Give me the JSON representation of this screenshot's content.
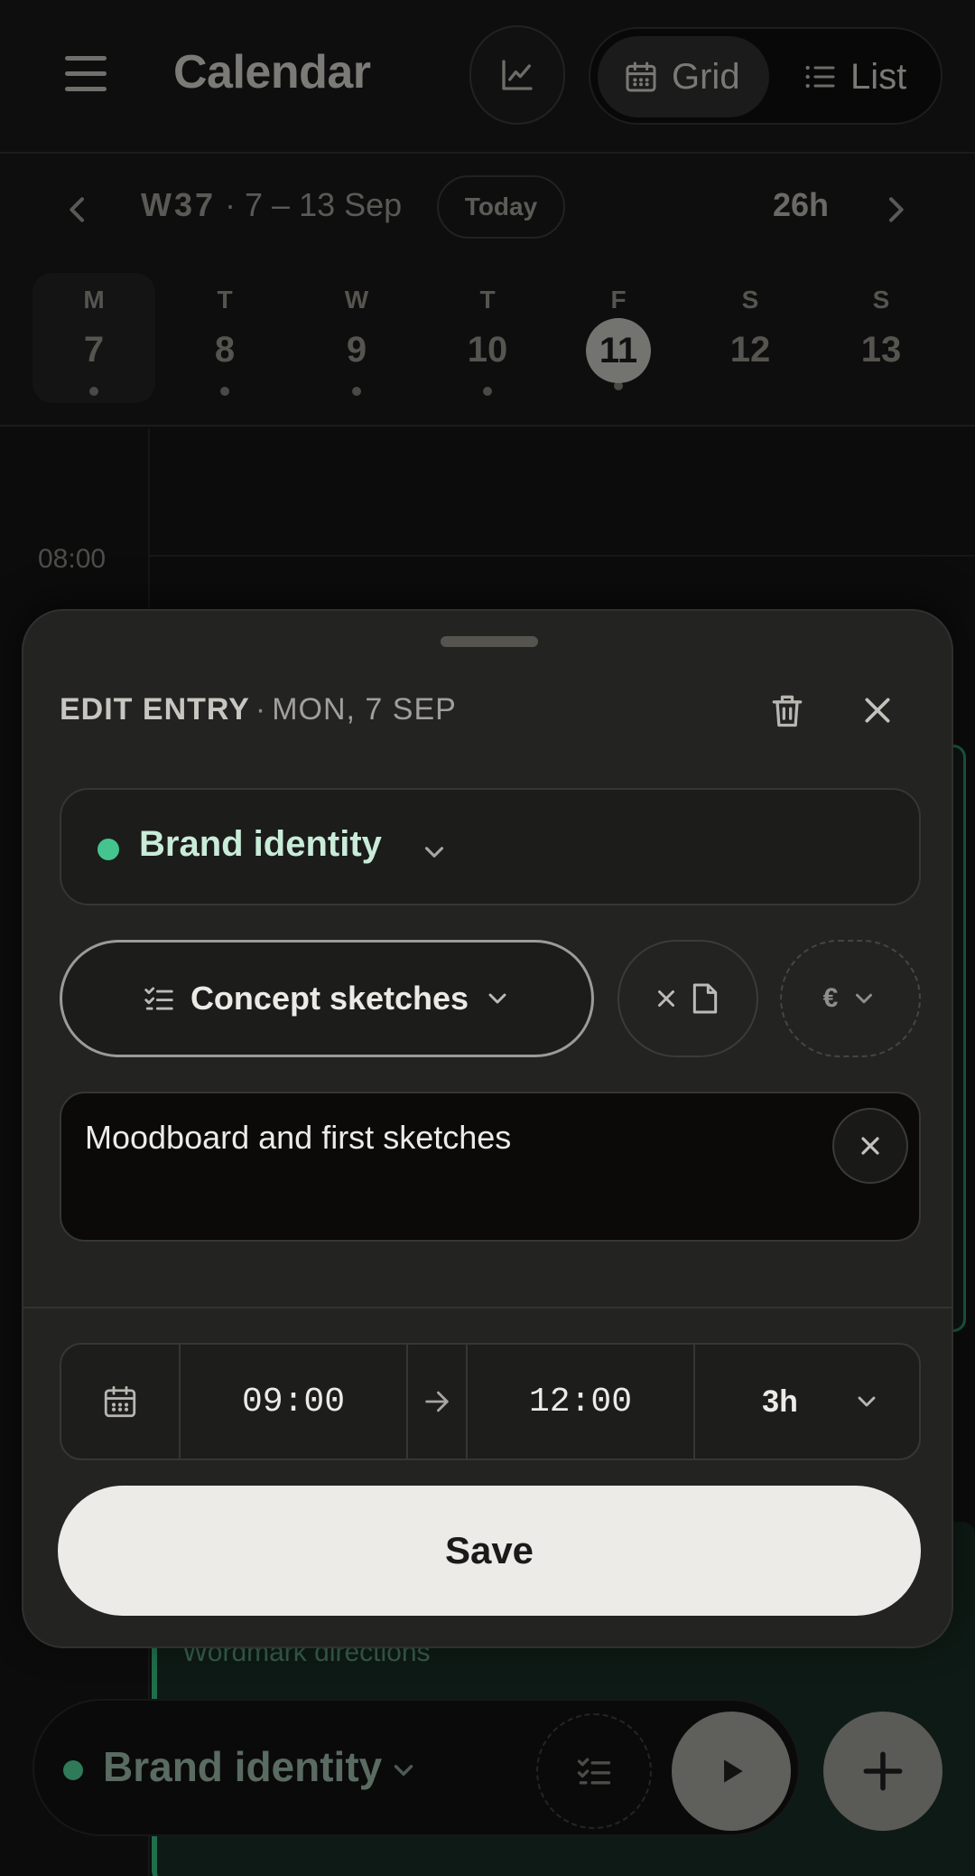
{
  "header": {
    "title": "Calendar",
    "view_options": [
      {
        "label": "Grid",
        "selected": true
      },
      {
        "label": "List",
        "selected": false
      }
    ]
  },
  "week": {
    "label_week": "W37",
    "label_range": "· 7 – 13 Sep",
    "today_label": "Today",
    "total_hours": "26h",
    "days": [
      {
        "name": "M",
        "num": "7",
        "selected": true,
        "today": false
      },
      {
        "name": "T",
        "num": "8",
        "selected": false,
        "today": false
      },
      {
        "name": "W",
        "num": "9",
        "selected": false,
        "today": false
      },
      {
        "name": "T",
        "num": "10",
        "selected": false,
        "today": false
      },
      {
        "name": "F",
        "num": "11",
        "selected": false,
        "today": true
      },
      {
        "name": "S",
        "num": "12",
        "selected": false,
        "today": false
      },
      {
        "name": "S",
        "num": "13",
        "selected": false,
        "today": false
      }
    ]
  },
  "calendar": {
    "time_label": "08:00",
    "event_subtitle": "Wordmark directions"
  },
  "sheet": {
    "title_bold": "EDIT ENTRY",
    "title_sep": "·",
    "title_date": "MON, 7 SEP",
    "project": {
      "label": "Brand identity",
      "color": "#44c48e"
    },
    "task": {
      "label": "Concept sketches"
    },
    "billing": {
      "symbol": "€"
    },
    "description": "Moodboard and first sketches",
    "start_time": "09:00",
    "end_time": "12:00",
    "duration": "3h",
    "save_label": "Save"
  },
  "tracker": {
    "project_label": "Brand identity",
    "project_color": "#2f7a58"
  },
  "icons": {
    "menu": "hamburger-icon",
    "stats": "chart-line-icon",
    "grid": "calendar-icon",
    "list": "list-icon",
    "delete": "trash-icon",
    "close": "close-icon",
    "task": "checklist-icon",
    "file": "file-icon",
    "play": "play-icon",
    "add": "plus-icon"
  }
}
